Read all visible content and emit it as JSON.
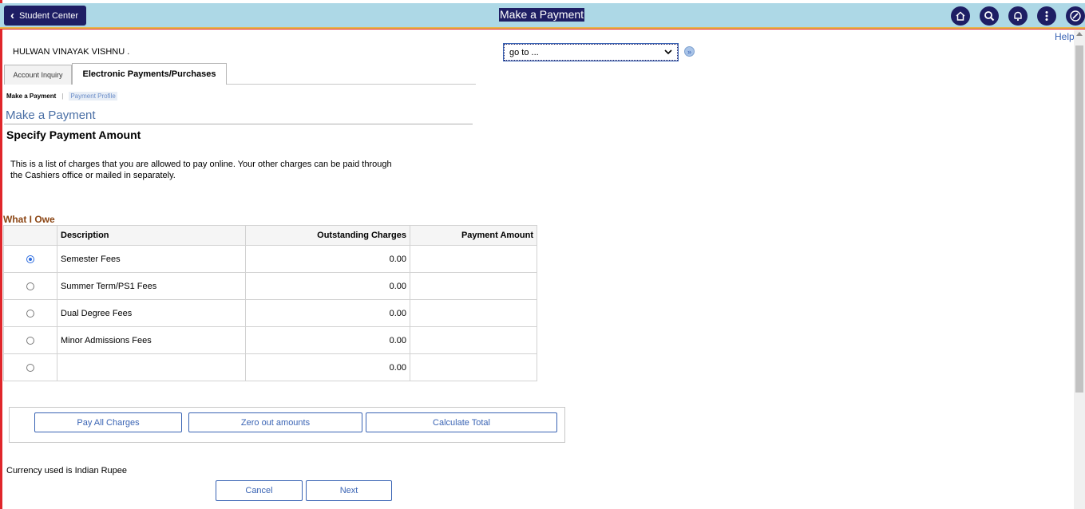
{
  "header": {
    "back_label": "Student Center",
    "page_title": "Make a Payment",
    "help_label": "Help",
    "icons": [
      "home-icon",
      "search-icon",
      "bell-icon",
      "more-vertical-icon",
      "compass-icon"
    ]
  },
  "student": {
    "name": "HULWAN VINAYAK VISHNU ."
  },
  "goto": {
    "selected": "go to ..."
  },
  "tabs": [
    {
      "label": "Account Inquiry",
      "active": false
    },
    {
      "label": "Electronic Payments/Purchases",
      "active": true
    }
  ],
  "subnav": {
    "current": "Make a Payment",
    "separator": "|",
    "link": "Payment Profile"
  },
  "main": {
    "title": "Make a Payment",
    "subtitle": "Specify Payment Amount",
    "intro": "This is a list of charges that you are allowed to pay online. Your other charges can be paid through the Cashiers office or mailed in separately."
  },
  "owe": {
    "title": "What I Owe",
    "columns": [
      "Description",
      "Outstanding Charges",
      "Payment Amount"
    ],
    "rows": [
      {
        "description": "Semester Fees",
        "outstanding": "0.00",
        "payment": "",
        "selected": true
      },
      {
        "description": "Summer Term/PS1 Fees",
        "outstanding": "0.00",
        "payment": "",
        "selected": false
      },
      {
        "description": "Dual Degree Fees",
        "outstanding": "0.00",
        "payment": "",
        "selected": false
      },
      {
        "description": "Minor Admissions Fees",
        "outstanding": "0.00",
        "payment": "",
        "selected": false
      },
      {
        "description": "",
        "outstanding": "0.00",
        "payment": "",
        "selected": false
      }
    ]
  },
  "actions": {
    "pay_all": "Pay All Charges",
    "zero_out": "Zero out amounts",
    "calculate": "Calculate Total"
  },
  "footer": {
    "currency": "Currency used is Indian Rupee",
    "cancel": "Cancel",
    "next": "Next"
  },
  "colors": {
    "banner": "#add8e6",
    "brand_dark": "#1e1e64",
    "link_blue": "#3a64b4",
    "section_brown": "#8b4513",
    "frame_red": "#e0262b"
  }
}
